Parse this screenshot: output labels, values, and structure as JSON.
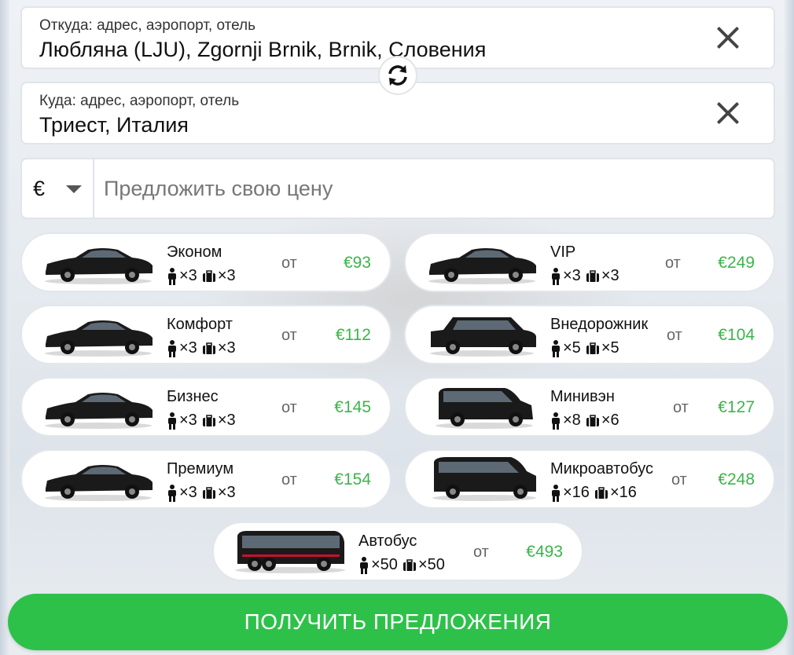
{
  "from": {
    "label": "Откуда: адрес, аэропорт, отель",
    "value": "Любляна (LJU), Zgornji Brnik, Brnik, Словения"
  },
  "to": {
    "label": "Куда: адрес, аэропорт, отель",
    "value": "Триест, Италия"
  },
  "price_offer": {
    "currency": "€",
    "placeholder": "Предложить свою цену"
  },
  "from_label": "от",
  "vehicles": [
    {
      "name": "Эконом",
      "passengers": "×3",
      "luggage": "×3",
      "price": "€93"
    },
    {
      "name": "VIP",
      "passengers": "×3",
      "luggage": "×3",
      "price": "€249"
    },
    {
      "name": "Комфорт",
      "passengers": "×3",
      "luggage": "×3",
      "price": "€112"
    },
    {
      "name": "Внедорожник",
      "passengers": "×5",
      "luggage": "×5",
      "price": "€104"
    },
    {
      "name": "Бизнес",
      "passengers": "×3",
      "luggage": "×3",
      "price": "€145"
    },
    {
      "name": "Минивэн",
      "passengers": "×8",
      "luggage": "×6",
      "price": "€127"
    },
    {
      "name": "Премиум",
      "passengers": "×3",
      "luggage": "×3",
      "price": "€154"
    },
    {
      "name": "Микроавтобус",
      "passengers": "×16",
      "luggage": "×16",
      "price": "€248"
    },
    {
      "name": "Автобус",
      "passengers": "×50",
      "luggage": "×50",
      "price": "€493"
    }
  ],
  "submit_label": "ПОЛУЧИТЬ ПРЕДЛОЖЕНИЯ",
  "colors": {
    "accent": "#2ec14a",
    "price": "#3bb54a"
  }
}
